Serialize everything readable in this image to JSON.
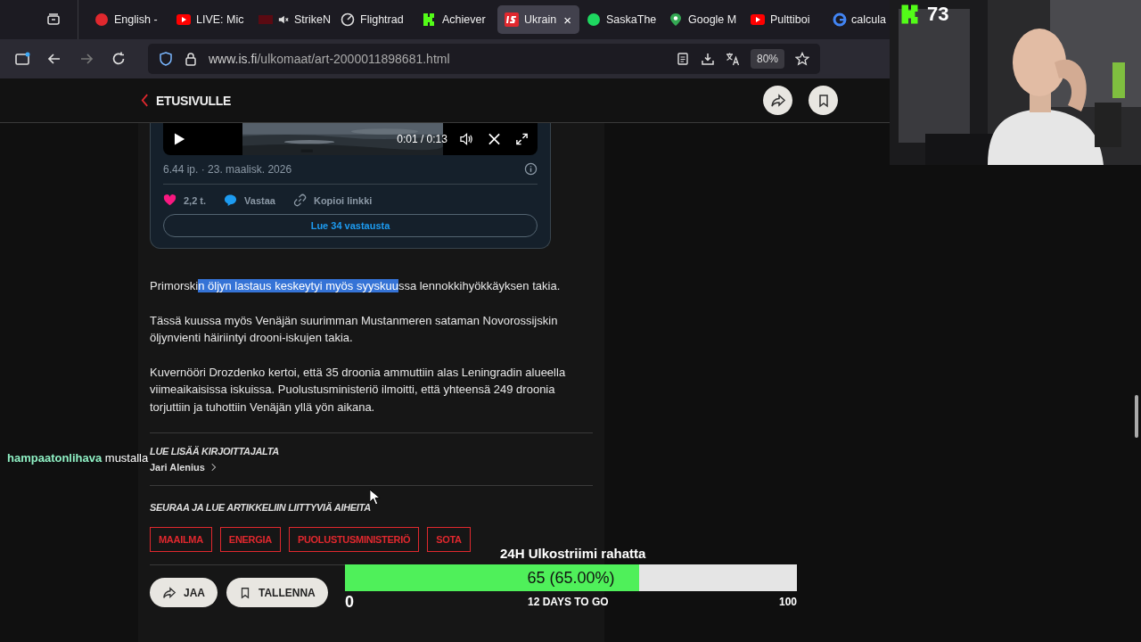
{
  "browser": {
    "tabs": [
      {
        "title": "English -",
        "kind": "circle",
        "color": "#e0282e",
        "selected": false,
        "muted": false
      },
      {
        "title": "LIVE: Mic",
        "kind": "play",
        "color": "#ff0000",
        "selected": false,
        "muted": false
      },
      {
        "title": "StrikeN",
        "kind": "square",
        "color": "#5a0a12",
        "selected": false,
        "muted": true
      },
      {
        "title": "Flightrad",
        "kind": "radar",
        "color": "#dddddd",
        "selected": false,
        "muted": false
      },
      {
        "title": "Achiever",
        "kind": "k",
        "color": "#53fc18",
        "selected": false,
        "muted": false
      },
      {
        "title": "Ukrain",
        "kind": "is",
        "color": "#e0282e",
        "selected": true,
        "muted": false,
        "close": "×"
      },
      {
        "title": "SaskaThe",
        "kind": "circle",
        "color": "#1ed760",
        "selected": false,
        "muted": false
      },
      {
        "title": "Google M",
        "kind": "pin",
        "color": "#34a853",
        "selected": false,
        "muted": false
      },
      {
        "title": "Pulttiboi",
        "kind": "play",
        "color": "#ff0000",
        "selected": false,
        "muted": false
      },
      {
        "title": "calcula",
        "kind": "g",
        "color": "#4285f4",
        "selected": false,
        "muted": false
      }
    ],
    "url": {
      "host": "www.is.fi",
      "path": "/ulkomaat/art-2000011898681.html"
    },
    "zoom": "80%"
  },
  "site_header": {
    "back_link": "ETUSIVULLE"
  },
  "tweet": {
    "time": "0:01 / 0:13",
    "date": "6.44 ip. · 23. maalisk. 2026",
    "likes": "2,2 t.",
    "reply": "Vastaa",
    "copy_link": "Kopioi linkki",
    "read_replies": "Lue 34 vastausta"
  },
  "paragraphs": [
    {
      "before": "Primorski",
      "selection": "n öljyn lastaus keskeytyi myös syyskuu",
      "after": "ssa lennokkihyökkäyksen takia."
    },
    {
      "before": "Tässä kuussa myös Venäjän suurimman Mustanmeren sataman Novorossijskin öljynvienti häiriintyi drooni-iskujen takia."
    },
    {
      "before": "Kuvernööri Drozdenko kertoi, että 35 droonia ammuttiin alas Leningradin alueella viimeaikaisissa iskuissa. Puolustusministeriö ilmoitti, että yhteensä 249 droonia torjuttiin ja tuhottiin Venäjän yllä yön aikana."
    }
  ],
  "author": {
    "heading": "LUE LISÄÄ KIRJOITTAJALTA",
    "name": "Jari Alenius"
  },
  "topics": {
    "heading": "SEURAA JA LUE ARTIKKELIIN LIITTYVIÄ AIHEITA",
    "tags": [
      "MAAILMA",
      "ENERGIA",
      "PUOLUSTUSMINISTERIÖ",
      "SOTA"
    ]
  },
  "actions": [
    "JAA",
    "TALLENNA"
  ],
  "overlay": {
    "follower_count": "73",
    "chat": {
      "user": "hampaatonlihava",
      "message": "mustalla"
    },
    "goal": {
      "title": "24H Ulkostriimi rahatta",
      "level": 0.65,
      "reading": "65 (65.00%)",
      "min": "0",
      "remaining": "12 DAYS TO GO",
      "max": "100"
    }
  }
}
